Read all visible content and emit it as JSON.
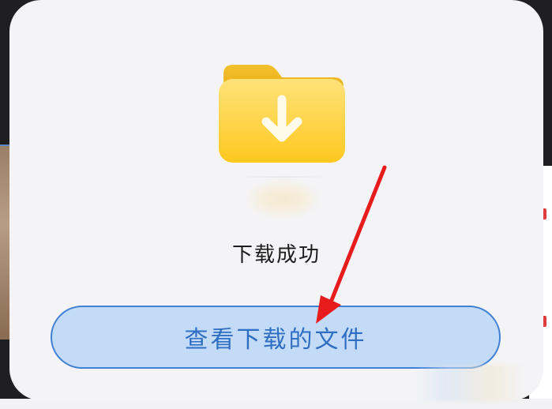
{
  "dialog": {
    "status_text": "下载成功",
    "view_button_label": "查看下载的文件"
  },
  "icons": {
    "folder": "folder-download-icon",
    "annotation": "red-arrow-annotation"
  },
  "colors": {
    "folder_yellow": "#ffcf2e",
    "button_fill": "#c3dbf6",
    "button_border": "#3f7fd3",
    "button_text": "#2f6fc3",
    "arrow_red": "#e81c1c"
  }
}
